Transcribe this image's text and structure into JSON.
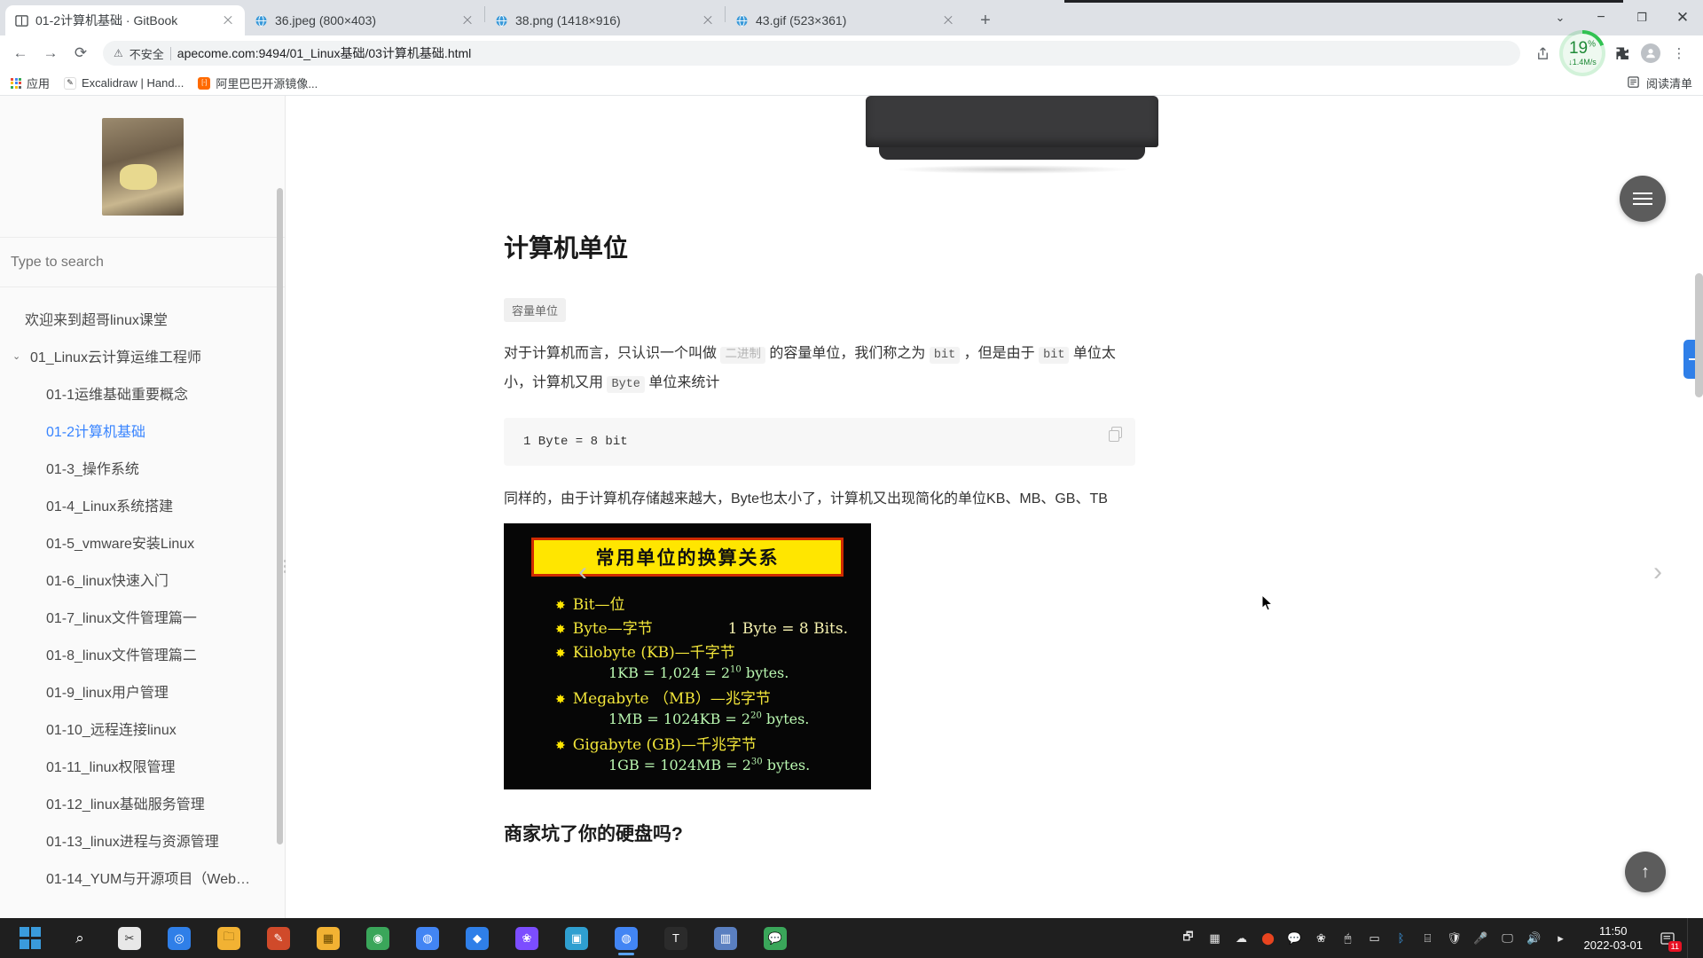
{
  "browser": {
    "tabs": [
      {
        "title": "01-2计算机基础 · GitBook",
        "favicon": "book-icon",
        "active": true
      },
      {
        "title": "36.jpeg (800×403)",
        "favicon": "globe-icon",
        "active": false
      },
      {
        "title": "38.png (1418×916)",
        "favicon": "globe-icon",
        "active": false
      },
      {
        "title": "43.gif (523×361)",
        "favicon": "globe-icon",
        "active": false
      }
    ],
    "new_tab_label": "+",
    "window_controls": {
      "tab_search": "⌄",
      "minimize": "−",
      "maximize": "❐",
      "close": "✕"
    },
    "nav": {
      "back": "←",
      "forward": "→",
      "reload": "⟳"
    },
    "omnibox": {
      "warning_icon": "⚠",
      "security_label": "不安全",
      "url": "apecome.com:9494/01_Linux基础/03计算机基础.html"
    },
    "toolbar_right": {
      "share_icon": "share-icon",
      "download_percent": "19",
      "download_percent_unit": "%",
      "download_speed": "↓1.4M/s",
      "extensions_icon": "puzzle-icon",
      "profile_icon": "avatar-icon",
      "menu_icon": "⋮"
    },
    "bookmarks": {
      "apps_label": "应用",
      "items": [
        {
          "label": "Excalidraw | Hand...",
          "icon_color": "#ffffff",
          "icon_glyph": "✎"
        },
        {
          "label": "阿里巴巴开源镜像...",
          "icon_color": "#ff6a00",
          "icon_glyph": "[-]"
        }
      ],
      "reading_list_label": "阅读清单",
      "reading_list_icon": "list-icon"
    }
  },
  "sidebar": {
    "logo_alt": "bear-avatar",
    "search_placeholder": "Type to search",
    "nav": [
      {
        "label": "欢迎来到超哥linux课堂",
        "level": "top",
        "active": false
      },
      {
        "label": "01_Linux云计算运维工程师",
        "level": "group",
        "active": false,
        "chevron": "⌄"
      },
      {
        "label": "01-1运维基础重要概念",
        "level": "child",
        "active": false
      },
      {
        "label": "01-2计算机基础",
        "level": "child",
        "active": true
      },
      {
        "label": "01-3_操作系统",
        "level": "child",
        "active": false
      },
      {
        "label": "01-4_Linux系统搭建",
        "level": "child",
        "active": false
      },
      {
        "label": "01-5_vmware安装Linux",
        "level": "child",
        "active": false
      },
      {
        "label": "01-6_linux快速入门",
        "level": "child",
        "active": false
      },
      {
        "label": "01-7_linux文件管理篇一",
        "level": "child",
        "active": false
      },
      {
        "label": "01-8_linux文件管理篇二",
        "level": "child",
        "active": false
      },
      {
        "label": "01-9_linux用户管理",
        "level": "child",
        "active": false
      },
      {
        "label": "01-10_远程连接linux",
        "level": "child",
        "active": false
      },
      {
        "label": "01-11_linux权限管理",
        "level": "child",
        "active": false
      },
      {
        "label": "01-12_linux基础服务管理",
        "level": "child",
        "active": false
      },
      {
        "label": "01-13_linux进程与资源管理",
        "level": "child",
        "active": false
      },
      {
        "label": "01-14_YUM与开源项目（Web…",
        "level": "child",
        "active": false
      }
    ]
  },
  "content": {
    "heading": "计算机单位",
    "badge": "容量单位",
    "paragraph1": {
      "p1": "对于计算机而言，只认识一个叫做",
      "code1": "二进制",
      "p2": "的容量单位，我们称之为",
      "code2": "bit",
      "p3": "，但是由于",
      "code3": "bit",
      "p4": "单位太小，计算机又用",
      "code4": "Byte",
      "p5": "单位来统计"
    },
    "codeblock": "1 Byte = 8 bit",
    "copy_label": "copy-icon",
    "paragraph2": "同样的，由于计算机存储越来越大，Byte也太小了，计算机又出现简化的单位KB、MB、GB、TB",
    "figure": {
      "title": "常用单位的换算关系",
      "rows": [
        {
          "bullet": "✸",
          "left": "Bit—位",
          "right": ""
        },
        {
          "bullet": "✸",
          "left": "Byte—字节",
          "right": "1 Byte = 8 Bits."
        },
        {
          "bullet": "✸",
          "left": "Kilobyte (KB)—千字节",
          "right": ""
        },
        {
          "bullet": "",
          "formula": "1KB = 1,024 = 2",
          "exp": "10",
          "formula_tail": " bytes."
        },
        {
          "bullet": "✸",
          "left": "Megabyte （MB）—兆字节",
          "right": ""
        },
        {
          "bullet": "",
          "formula": "1MB = 1024KB = 2",
          "exp": "20",
          "formula_tail": " bytes."
        },
        {
          "bullet": "✸",
          "left": "Gigabyte (GB)—千兆字节",
          "right": ""
        },
        {
          "bullet": "",
          "formula": "1GB = 1024MB = 2",
          "exp": "30",
          "formula_tail": " bytes."
        }
      ]
    },
    "heading2": "商家坑了你的硬盘吗?",
    "prev_arrow": "‹",
    "next_arrow": "›",
    "menu_fab": "hamburger-icon",
    "to_top_fab": "↑"
  },
  "taskbar": {
    "items": [
      {
        "name": "start-button",
        "glyph": "",
        "color": "#0078d4",
        "kind": "winlogo"
      },
      {
        "name": "search-button",
        "glyph": "⌕",
        "color": "transparent"
      },
      {
        "name": "app-snipaste",
        "glyph": "✂",
        "color": "#e8e8e8"
      },
      {
        "name": "app-search-globe",
        "glyph": "◎",
        "color": "#2f7fe8"
      },
      {
        "name": "file-explorer",
        "glyph": "🗀",
        "color": "#f2b233"
      },
      {
        "name": "app-editor",
        "glyph": "✎",
        "color": "#d04a2a"
      },
      {
        "name": "app-windows-store",
        "glyph": "▦",
        "color": "#f2b233"
      },
      {
        "name": "app-typora",
        "glyph": "◉",
        "color": "#3aa65a"
      },
      {
        "name": "app-chrome",
        "glyph": "◍",
        "color": "#4285f4"
      },
      {
        "name": "app-vscode",
        "glyph": "◆",
        "color": "#2f7fe8"
      },
      {
        "name": "app-photos",
        "glyph": "❀",
        "color": "#7c4dff"
      },
      {
        "name": "app-gallery",
        "glyph": "▣",
        "color": "#2f9fd0"
      },
      {
        "name": "app-chrome-2",
        "glyph": "◍",
        "color": "#4285f4",
        "running": true
      },
      {
        "name": "app-typora-2",
        "glyph": "T",
        "color": "#2b2b2b"
      },
      {
        "name": "app-window",
        "glyph": "▥",
        "color": "#5a7fc0"
      },
      {
        "name": "app-wechat",
        "glyph": "💬",
        "color": "#3aa65a"
      }
    ],
    "tray": [
      {
        "name": "tray-display",
        "glyph": "🗗"
      },
      {
        "name": "tray-apps",
        "glyph": "▦"
      },
      {
        "name": "tray-cloud",
        "glyph": "☁"
      },
      {
        "name": "tray-recorder",
        "glyph": "⬤"
      },
      {
        "name": "tray-wechat",
        "glyph": "💬"
      },
      {
        "name": "tray-flower",
        "glyph": "❀"
      },
      {
        "name": "tray-mouse",
        "glyph": "🖱"
      },
      {
        "name": "tray-battery",
        "glyph": "▭"
      },
      {
        "name": "tray-bluetooth",
        "glyph": "ᛒ"
      },
      {
        "name": "tray-usb",
        "glyph": "⌸"
      },
      {
        "name": "tray-shield",
        "glyph": "🛡"
      },
      {
        "name": "tray-mic",
        "glyph": "🎤"
      },
      {
        "name": "tray-monitor",
        "glyph": "🖵"
      },
      {
        "name": "tray-volume",
        "glyph": "🔊"
      },
      {
        "name": "tray-expand",
        "glyph": "▸"
      }
    ],
    "clock_time": "11:50",
    "clock_date": "2022-03-01",
    "notification_count": "11"
  }
}
